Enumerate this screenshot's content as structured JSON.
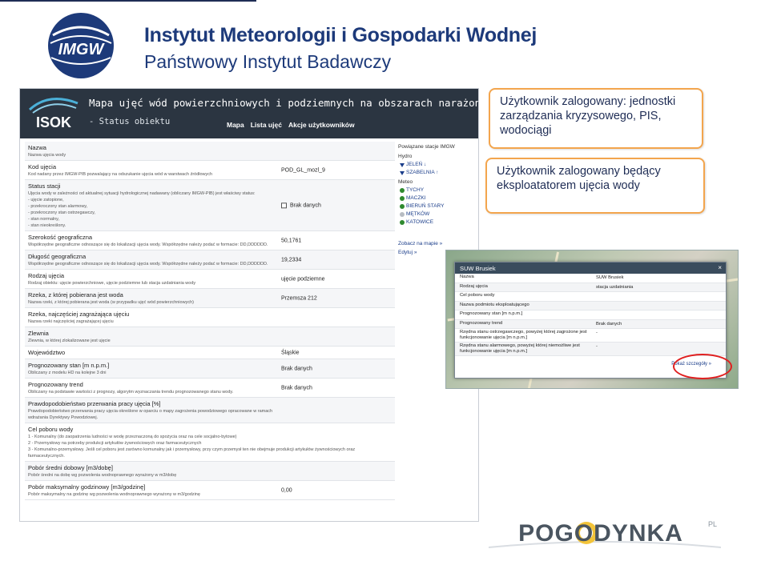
{
  "header": {
    "title": "Instytut Meteorologii i Gospodarki Wodnej",
    "subtitle": "Państwowy Instytut Badawczy",
    "logo_text": "IMGW"
  },
  "app": {
    "logo_text": "ISOK",
    "title": "Mapa ujęć wód powierzchniowych i podziemnych na obszarach narażonych na niebe",
    "subtitle": "- Status obiektu",
    "nav": [
      "Mapa",
      "Lista ujęć",
      "Akcje użytkowników"
    ],
    "fields": [
      {
        "label": "Nazwa",
        "desc": "Nazwa ujęcia wody",
        "value": ""
      },
      {
        "label": "Kod ujęcia",
        "desc": "Kod nadany przez IMGW-PIB pozwalający na odszukanie ujęcia wód w warstwach źródłowych",
        "value": "POD_GL_mozl_9"
      },
      {
        "label": "Status stacji",
        "desc": "Ujęcia wody w zależności od aktualnej sytuacji hydrologicznej nadawany (obliczany IMGW-PIB) jest właściwy status:",
        "bullets": [
          "- ujęcie zatopione,",
          "- przekroczony stan alarmowy,",
          "- przekroczony stan ostrzegawczy,",
          "- stan normalny,",
          "- stan nieokreślony."
        ],
        "value": "Brak danych"
      },
      {
        "label": "Szerokość geograficzna",
        "desc": "Współrzędne geograficzne odnoszące się do lokalizacji ujęcia wody. Współrzędne należy podać w formacie: DD,DDDDDD.",
        "value": "50,1761"
      },
      {
        "label": "Długość geograficzna",
        "desc": "Współrzędne geograficzne odnoszące się do lokalizacji ujęcia wody. Współrzędne należy podać w formacie: DD,DDDDDD.",
        "value": "19,2334"
      },
      {
        "label": "Rodzaj ujęcia",
        "desc": "Rodzaj obiektu: ujęcie powierzchniowe, ujęcie podziemne lub stacja uzdatniania wody",
        "value": "ujęcie podziemne"
      },
      {
        "label": "Rzeka, z której pobierana jest woda",
        "desc": "Nazwa rzeki, z której pobierana jest woda (w przypadku ujęć wód powierzchniowych)",
        "value": "Przemsza 212"
      },
      {
        "label": "Rzeka, najczęściej zagrażająca ujęciu",
        "desc": "Nazwa rzeki najczęściej zagrażającej ujęciu",
        "value": ""
      },
      {
        "label": "Zlewnia",
        "desc": "Zlewnia, w której zlokalizowane jest ujęcie",
        "value": ""
      },
      {
        "label": "Województwo",
        "desc": "",
        "value": "Śląskie"
      },
      {
        "label": "Prognozowany stan [m n.p.m.]",
        "desc": "Obliczany z modelu HD na kolejne 3 dni",
        "value": "Brak danych"
      },
      {
        "label": "Prognozowany trend",
        "desc": "Obliczany na podstawie wartości z prognozy, algorytm wyznaczania trendu prognozowanego stanu wody.",
        "value": "Brak danych"
      },
      {
        "label": "Prawdopodobieństwo przerwania pracy ujęcia [%]",
        "desc": "Prawdopodobieństwo przerwania pracy ujęcia określone w oparciu o mapy zagrożenia powodziowego opracowane w ramach wdrażania Dyrektywy Powodziowej.",
        "value": ""
      },
      {
        "label": "Cel poboru wody",
        "desc": "",
        "bullets": [
          "1 - Komunalny (do zaopatrzenia ludności w wodę przeznaczoną do spożycia oraz na cele socjalno-bytowe)",
          "2 - Przemysłowy na potrzeby produkcji artykułów żywnościowych oraz farmaceutycznych",
          "3 - Komunalno-przemysłowy. Jeśli cel poboru jest zarówno komunalny jak i przemysłowy, przy czym przemysł ten nie obejmuje produkcji artykułów żywnościowych oraz farmaceutycznych."
        ],
        "value": ""
      },
      {
        "label": "Pobór średni dobowy [m3/dobę]",
        "desc": "Pobór średni na dobę wg pozwolenia wodnoprawnego wyrażony w m3/dobę",
        "value": ""
      },
      {
        "label": "Pobór maksymalny godzinowy [m3/godzinę]",
        "desc": "Pobór maksymalny na godzinę wg pozwolenia wodnoprawnego wyrażony w m3/godzinę",
        "value": "0,00"
      }
    ],
    "side": {
      "heading": "Powiązane stacje IMGW",
      "hydro_heading": "Hydro",
      "hydro": [
        {
          "name": "JELEŃ",
          "arrow": "↓"
        },
        {
          "name": "SZABELNIA",
          "arrow": "↑"
        }
      ],
      "meteo_heading": "Meteo",
      "meteo": [
        "TYCHY",
        "MACZKI",
        "BIERUŃ STARY",
        "MĘTKÓW",
        "KATOWICE"
      ],
      "links": [
        "Zobacz na mapie »",
        "Edytuj »"
      ]
    }
  },
  "callouts": [
    "Użytkownik zalogowany: jednostki zarządzania kryzysowego, PIS, wodociągi",
    "Użytkownik zalogowany będący eksploatatorem ujęcia wody"
  ],
  "map_window": {
    "title": "SUW Brusiek",
    "close": "×",
    "rows": [
      {
        "label": "Nazwa",
        "value": "SUW Brusiek"
      },
      {
        "label": "Rodzaj ujęcia",
        "value": "stacja uzdatniania"
      },
      {
        "label": "Cel poboru wody",
        "value": ""
      },
      {
        "label": "Nazwa podmiotu eksploatującego",
        "value": ""
      },
      {
        "label": "Prognozowany stan [m n.p.m.]",
        "value": ""
      },
      {
        "label": "Prognozowany trend",
        "value": "Brak danych"
      },
      {
        "label": "Rzędna stanu ostrzegawczego, powyżej której zagrożone jest funkcjonowanie ujęcia [m n.p.m.]",
        "value": "-"
      },
      {
        "label": "Rzędna stanu alarmowego, powyżej której niemożliwe jest funkcjonowanie ujęcia [m n.p.m.]",
        "value": "-"
      }
    ],
    "more": "Pokaż szczegóły »"
  },
  "footer": {
    "logo_text": "POGODYNKA",
    "logo_suffix": "PL"
  },
  "colors": {
    "brand_navy": "#1d3a7a",
    "callout_border": "#f3a54d",
    "highlight_ring": "#e02020",
    "app_header": "#2b3541",
    "station_green": "#2f8a2f"
  }
}
